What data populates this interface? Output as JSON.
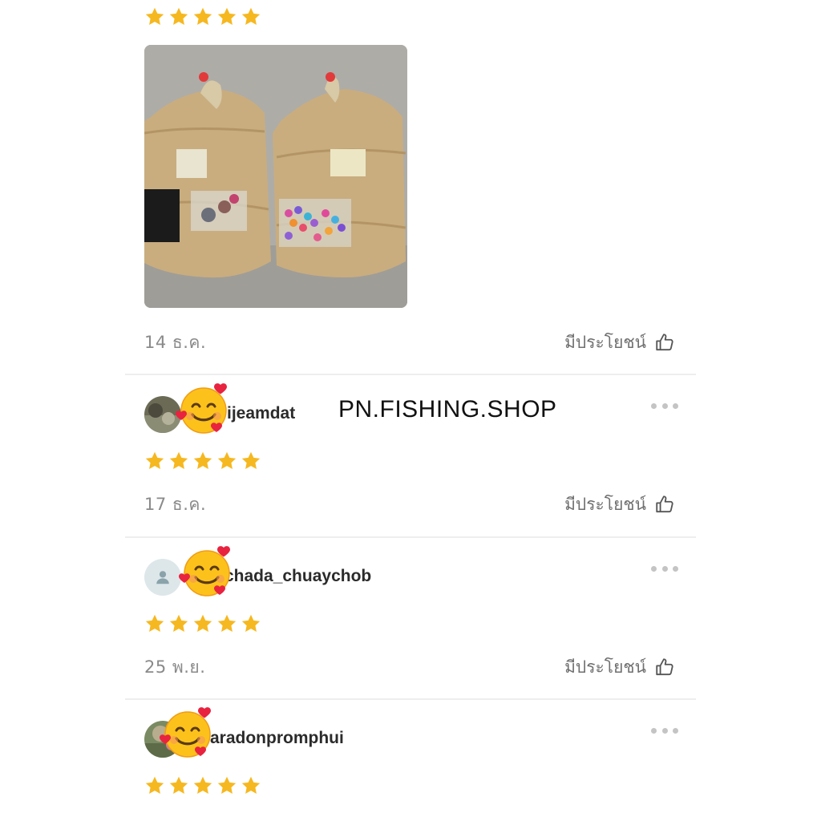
{
  "shop_name": "PN.FISHING.SHOP",
  "helpful_label": "มีประโยชน์",
  "rating_color": "#f6b820",
  "reviews": [
    {
      "date": "14 ธ.ค.",
      "stars": 5,
      "has_photo": true
    },
    {
      "username": "ijeamdat",
      "stars": 5,
      "date": "17 ธ.ค.",
      "avatar": "photo"
    },
    {
      "username": "chada_chuaychob",
      "stars": 5,
      "date": "25 พ.ย.",
      "avatar": "default-user-icon"
    },
    {
      "username": "aradonpromphui",
      "stars": 5,
      "avatar": "photo"
    }
  ],
  "icons": {
    "star": "star-icon",
    "thumbs_up": "thumbs-up-icon",
    "more": "more-options-icon",
    "emoji": "smiling-face-with-hearts-emoji"
  }
}
